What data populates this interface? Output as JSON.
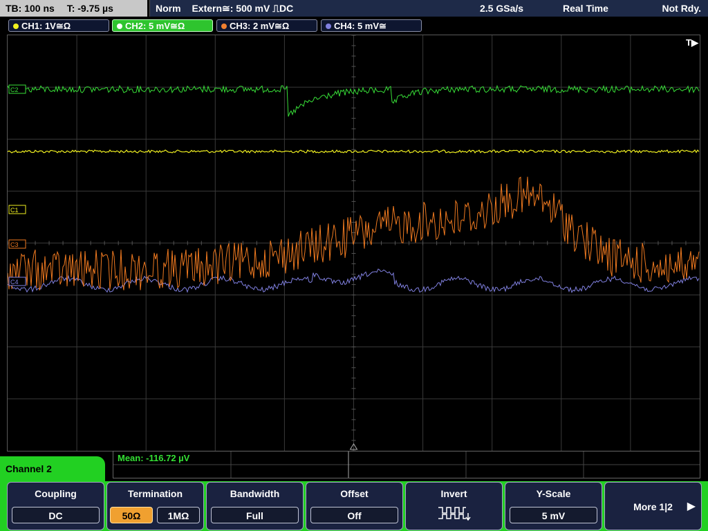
{
  "status": {
    "timebase": "TB: 100 ns",
    "trigger_offset": "T: -9.75 µs",
    "mode": "Norm",
    "trigger_source": "Extern≅: 500 mV ⎍DC",
    "sample_rate": "2.5 GSa/s",
    "acq_mode": "Real Time",
    "state": "Not Rdy."
  },
  "channels": [
    {
      "label": "CH1: 1V≅Ω",
      "color": "#f0f020"
    },
    {
      "label": "CH2: 5 mV≅Ω",
      "color": "#40e040",
      "active": true
    },
    {
      "label": "CH3: 2 mV≅Ω",
      "color": "#f08030"
    },
    {
      "label": "CH4: 5 mV≅",
      "color": "#8080e0"
    }
  ],
  "plot": {
    "trigger_marker": "T▶",
    "markers": [
      "C2",
      "C1",
      "C3",
      "C4"
    ]
  },
  "measurement": {
    "text": "Mean: -116.72 µV"
  },
  "menu_title": "Channel 2",
  "softkeys": {
    "coupling": {
      "title": "Coupling",
      "value": "DC"
    },
    "termination": {
      "title": "Termination",
      "opt1": "50Ω",
      "opt2": "1MΩ"
    },
    "bandwidth": {
      "title": "Bandwidth",
      "value": "Full"
    },
    "offset": {
      "title": "Offset",
      "value": "Off"
    },
    "invert": {
      "title": "Invert"
    },
    "yscale": {
      "title": "Y-Scale",
      "value": "5 mV"
    },
    "more": {
      "label": "More 1|2"
    }
  }
}
